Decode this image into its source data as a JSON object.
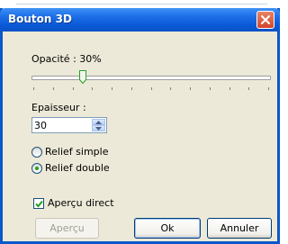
{
  "window": {
    "title": "Bouton 3D"
  },
  "opacity": {
    "label": "Opacité : 30%",
    "value_percent": 30,
    "tick_count": 13
  },
  "thickness": {
    "label": "Epaisseur :",
    "value": "30"
  },
  "relief": {
    "options": [
      {
        "label": "Relief simple",
        "selected": false
      },
      {
        "label": "Relief double",
        "selected": true
      }
    ]
  },
  "live_preview": {
    "label": "Aperçu direct",
    "checked": true
  },
  "buttons": {
    "preview": "Aperçu",
    "ok": "Ok",
    "cancel": "Annuler"
  },
  "colors": {
    "titlebar": "#0b5ad8",
    "close": "#d4462b",
    "face": "#ece9d8"
  },
  "icons": {
    "close": "close-icon",
    "spin_up": "spin-up-icon",
    "spin_down": "spin-down-icon",
    "check": "checkmark-icon"
  }
}
